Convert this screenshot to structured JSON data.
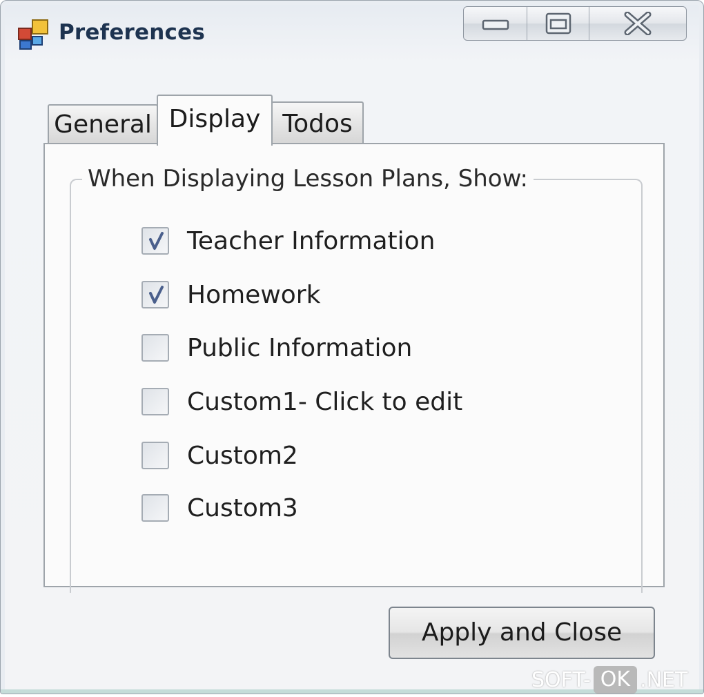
{
  "window": {
    "title": "Preferences",
    "icon": "app-window-icon"
  },
  "caption_buttons": {
    "minimize_icon": "minimize-icon",
    "maximize_icon": "maximize-icon",
    "close_icon": "close-icon"
  },
  "tabs": [
    {
      "label": "General",
      "selected": false
    },
    {
      "label": "Display",
      "selected": true
    },
    {
      "label": "Todos",
      "selected": false
    }
  ],
  "group": {
    "legend": "When Displaying Lesson Plans, Show:"
  },
  "options": [
    {
      "label": "Teacher Information",
      "checked": true
    },
    {
      "label": "Homework",
      "checked": true
    },
    {
      "label": "Public Information",
      "checked": false
    },
    {
      "label": "Custom1- Click to edit",
      "checked": false
    },
    {
      "label": "Custom2",
      "checked": false
    },
    {
      "label": "Custom3",
      "checked": false
    }
  ],
  "footer": {
    "apply_label": "Apply and Close"
  },
  "watermark": {
    "prefix": "SOFT-",
    "badge": "OK",
    "suffix": ".NET"
  },
  "colors": {
    "title_text": "#1d3350",
    "check_mark": "#4a5f8c",
    "panel_background": "#fbfbfb"
  }
}
